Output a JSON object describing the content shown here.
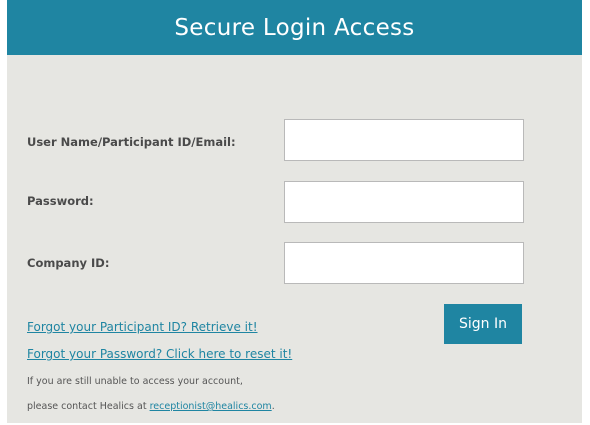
{
  "header": {
    "title": "Secure Login Access"
  },
  "form": {
    "username_label": "User Name/Participant ID/Email:",
    "username_value": "",
    "password_label": "Password:",
    "password_value": "",
    "company_label": "Company ID:",
    "company_value": "",
    "signin_label": "Sign In"
  },
  "links": {
    "forgot_id": "Forgot your Participant ID? Retrieve it!",
    "forgot_password": "Forgot your Password? Click here to reset it!"
  },
  "help": {
    "line1": "If you are still unable to access your account,",
    "line2_prefix": "please contact Healics at ",
    "email": "receptionist@healics.com",
    "line2_suffix": "."
  },
  "colors": {
    "accent": "#1f85a2",
    "panel_bg": "#e6e6e2",
    "label_text": "#4a4a4a"
  }
}
